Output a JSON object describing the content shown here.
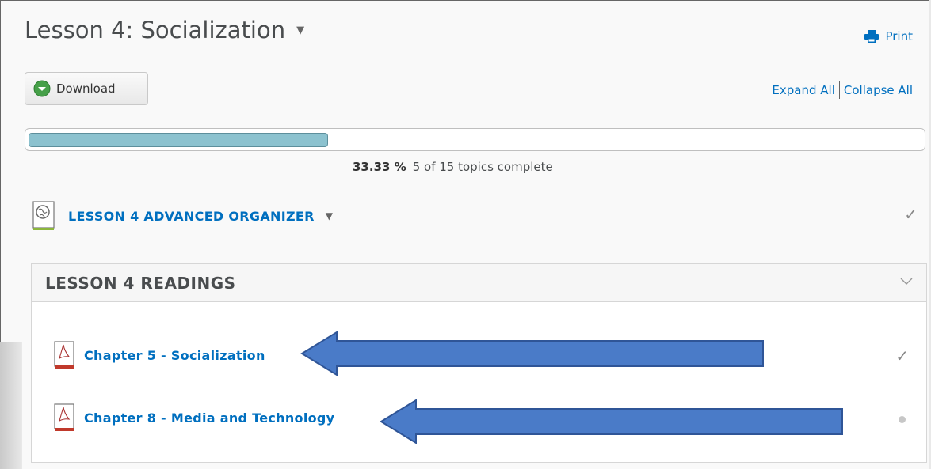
{
  "header": {
    "title": "Lesson 4: Socialization",
    "title_menu_icon": "caret-down-icon",
    "print_label": "Print",
    "print_icon": "printer-icon"
  },
  "toolbar": {
    "download_label": "Download",
    "download_icon": "download-circle-icon",
    "expand_all": "Expand All",
    "collapse_all": "Collapse All"
  },
  "progress": {
    "percent_text": "33.33 %",
    "status_text": "5 of 15 topics complete",
    "fraction": 0.3333,
    "fill_color": "#8cc2cf"
  },
  "module": {
    "title": "LESSON 4 ADVANCED ORGANIZER",
    "icon": "web-page-icon",
    "status": "complete"
  },
  "readings": {
    "title": "LESSON 4 READINGS",
    "toggle_icon": "chevron-down-icon",
    "topics": [
      {
        "title": "Chapter 5 - Socialization",
        "icon": "pdf-icon",
        "status": "complete"
      },
      {
        "title": "Chapter 8 - Media and Technology",
        "icon": "pdf-icon",
        "status": "incomplete"
      }
    ]
  },
  "colors": {
    "link": "#006fbf",
    "arrow": "#4a7bc8",
    "progress_fill": "#8cc2cf"
  }
}
